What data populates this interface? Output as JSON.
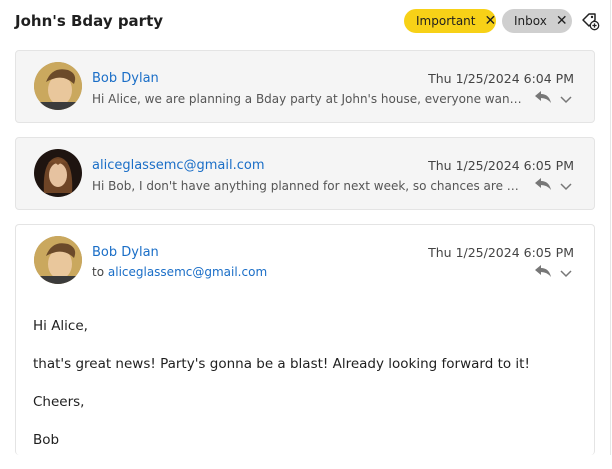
{
  "thread": {
    "subject": "John's Bday party",
    "tags": [
      {
        "label": "Important",
        "color": "#f7d117"
      },
      {
        "label": "Inbox",
        "color": "#cfcfcf"
      }
    ]
  },
  "messages": [
    {
      "sender": "Bob Dylan",
      "date": "Thu 1/25/2024 6:04 PM",
      "preview": "Hi Alice, we are planning a Bday party at John's house, everyone wants ..."
    },
    {
      "sender": "aliceglassemc@gmail.com",
      "date": "Thu 1/25/2024 6:05 PM",
      "preview": "Hi Bob, I don't have anything planned for next week, so chances are I'll ..."
    },
    {
      "sender": "Bob Dylan",
      "date": "Thu 1/25/2024 6:05 PM",
      "to_prefix": "to",
      "to": "aliceglassemc@gmail.com",
      "body": [
        "Hi Alice,",
        "that's great news! Party's gonna be a blast! Already looking forward to it!",
        "Cheers,",
        "Bob"
      ]
    }
  ]
}
